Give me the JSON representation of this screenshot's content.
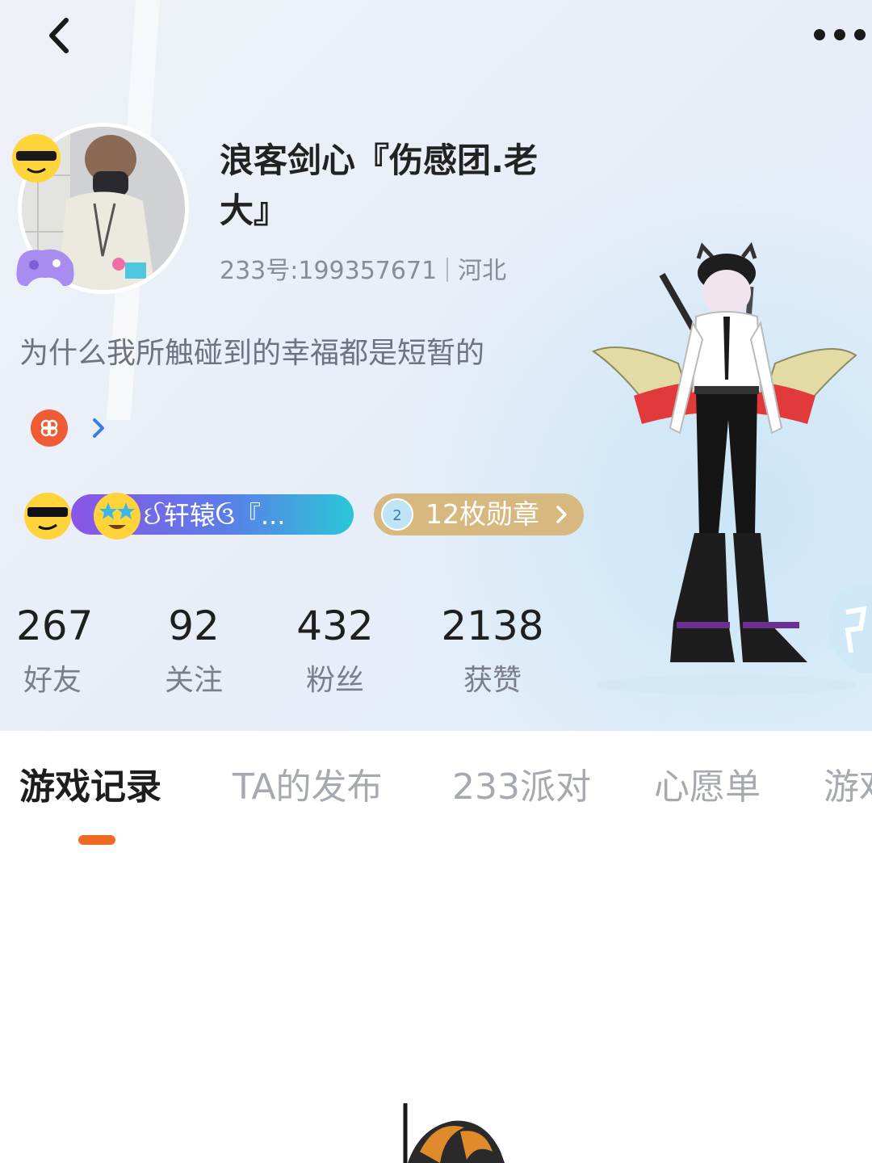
{
  "profile": {
    "nickname": "浪客剑心『伤感团.老大』",
    "id_label": "233号:199357671",
    "location": "河北",
    "bio": "为什么我所触碰到的幸福都是短暂的"
  },
  "badges": {
    "group_label": "ઈ轩辕ઉ『...",
    "medal_label": "12枚勋章",
    "medal_icon_text": "2"
  },
  "stats": [
    {
      "value": "267",
      "label": "好友"
    },
    {
      "value": "92",
      "label": "关注"
    },
    {
      "value": "432",
      "label": "粉丝"
    },
    {
      "value": "2138",
      "label": "获赞"
    }
  ],
  "tabs": [
    {
      "label": "游戏记录",
      "active": true
    },
    {
      "label": "TA的发布"
    },
    {
      "label": "233派对"
    },
    {
      "label": "心愿单"
    },
    {
      "label": "游戏"
    }
  ],
  "colors": {
    "accent": "#f26a22",
    "tag": "#ef5b34",
    "medal": "#d7b87f",
    "group_gradient": [
      "#8a55e6",
      "#2cc6d8"
    ]
  },
  "icons": {
    "back": "chevron-left-icon",
    "more": "more-dots-icon",
    "tag": "pinwheel-icon",
    "tag_arrow": "chevron-right-icon"
  }
}
